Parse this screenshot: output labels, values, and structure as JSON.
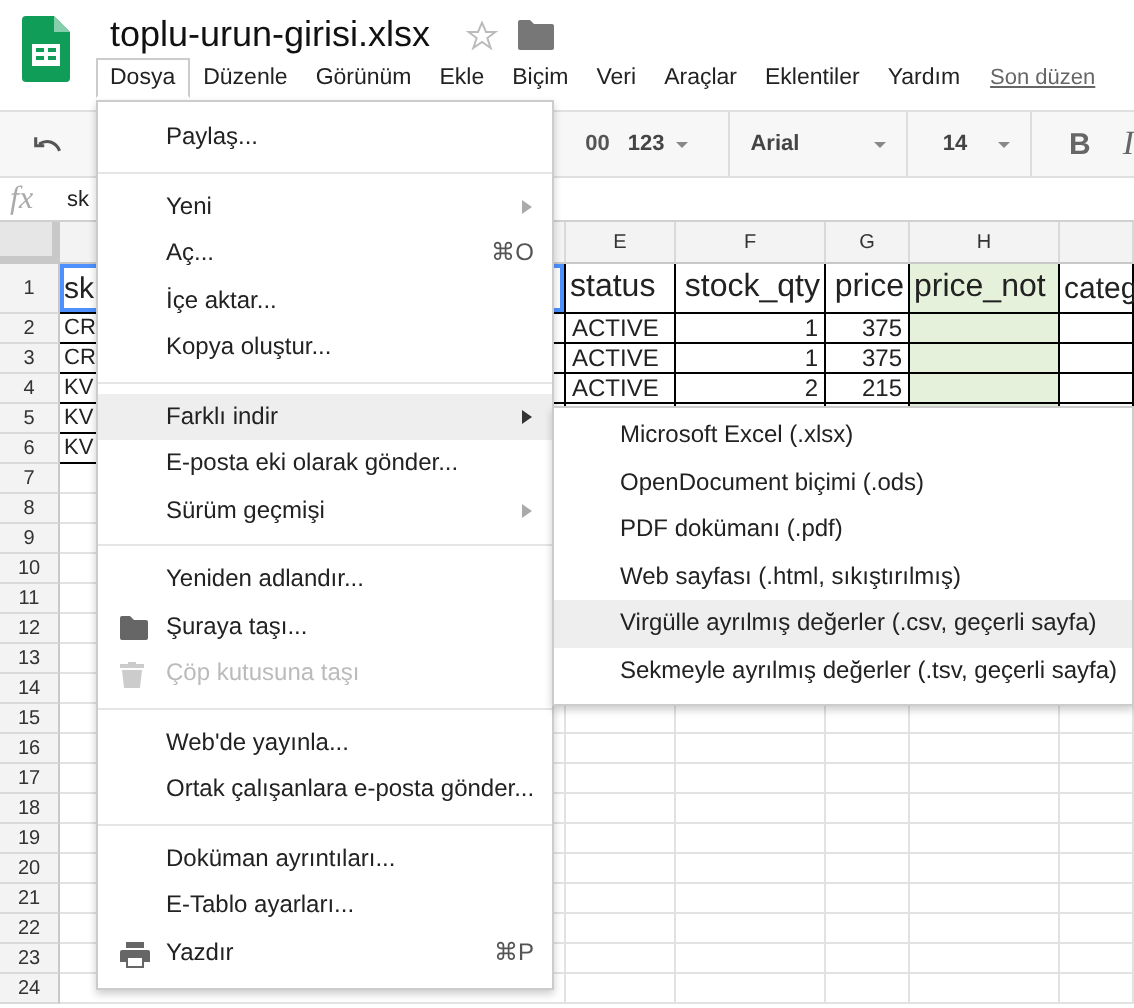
{
  "document": {
    "title": "toplu-urun-girisi.xlsx",
    "starred": false
  },
  "menubar": [
    {
      "label": "Dosya",
      "selected": true
    },
    {
      "label": "Düzenle",
      "selected": false
    },
    {
      "label": "Görünüm",
      "selected": false
    },
    {
      "label": "Ekle",
      "selected": false
    },
    {
      "label": "Biçim",
      "selected": false
    },
    {
      "label": "Veri",
      "selected": false
    },
    {
      "label": "Araçlar",
      "selected": false
    },
    {
      "label": "Eklentiler",
      "selected": false
    },
    {
      "label": "Yardım",
      "selected": false
    }
  ],
  "last_edit_link": "Son düzen",
  "toolbar": {
    "decimal": "00",
    "number_format": "123",
    "font": "Arial",
    "font_size": "14",
    "bold": "B",
    "italic": "I"
  },
  "formula_bar": {
    "fx": "fx",
    "value": "sk"
  },
  "sheet": {
    "columns": [
      {
        "label": "E",
        "numeric": false,
        "highlighted": false
      },
      {
        "label": "F",
        "numeric": true,
        "highlighted": false
      },
      {
        "label": "G",
        "numeric": true,
        "highlighted": false
      },
      {
        "label": "H",
        "numeric": false,
        "highlighted": true
      },
      {}
    ],
    "rows": [
      {
        "number": "1",
        "a": "sk",
        "header": true,
        "cells": [
          "status",
          "stock_qty",
          "price",
          "price_not",
          "categ"
        ]
      },
      {
        "number": "2",
        "a": "CR",
        "cells": [
          "ACTIVE",
          "1",
          "375"
        ]
      },
      {
        "number": "3",
        "a": "CR",
        "cells": [
          "ACTIVE",
          "1",
          "375"
        ]
      },
      {
        "number": "4",
        "a": "KV",
        "cells": [
          "ACTIVE",
          "2",
          "215"
        ]
      },
      {
        "number": "5",
        "a": "KV"
      },
      {
        "number": "6",
        "a": "KV"
      },
      {
        "number": "7"
      },
      {
        "number": "8"
      },
      {
        "number": "9"
      },
      {
        "number": "10"
      },
      {
        "number": "11"
      },
      {
        "number": "12"
      },
      {
        "number": "13"
      },
      {
        "number": "14"
      },
      {
        "number": "15"
      },
      {
        "number": "16"
      },
      {
        "number": "17"
      },
      {
        "number": "18"
      },
      {
        "number": "19"
      },
      {
        "number": "20"
      },
      {
        "number": "21"
      },
      {
        "number": "22"
      },
      {
        "number": "23"
      },
      {
        "number": "24"
      }
    ]
  },
  "file_menu": [
    {
      "kind": "item",
      "label": "Paylaş...",
      "selected": false,
      "disabled": false
    },
    {
      "kind": "separator"
    },
    {
      "kind": "item",
      "label": "Yeni",
      "submenu": true,
      "selected": false,
      "disabled": false
    },
    {
      "kind": "item",
      "label": "Aç...",
      "shortcut": "⌘O",
      "selected": false,
      "disabled": false
    },
    {
      "kind": "item",
      "label": "İçe aktar...",
      "selected": false,
      "disabled": false
    },
    {
      "kind": "item",
      "label": "Kopya oluştur...",
      "selected": false,
      "disabled": false
    },
    {
      "kind": "separator"
    },
    {
      "kind": "item",
      "label": "Farklı indir",
      "submenu": true,
      "selected": true,
      "disabled": false
    },
    {
      "kind": "item",
      "label": "E-posta eki olarak gönder...",
      "selected": false,
      "disabled": false
    },
    {
      "kind": "item",
      "label": "Sürüm geçmişi",
      "submenu": true,
      "selected": false,
      "disabled": false
    },
    {
      "kind": "separator"
    },
    {
      "kind": "item",
      "label": "Yeniden adlandır...",
      "selected": false,
      "disabled": false
    },
    {
      "kind": "item",
      "label": "Şuraya taşı...",
      "icon": true,
      "selected": false,
      "disabled": false
    },
    {
      "kind": "item",
      "label": "Çöp kutusuna taşı",
      "icon": true,
      "selected": false,
      "disabled": true
    },
    {
      "kind": "separator"
    },
    {
      "kind": "item",
      "label": "Web'de yayınla...",
      "selected": false,
      "disabled": false
    },
    {
      "kind": "item",
      "label": "Ortak çalışanlara e-posta gönder...",
      "selected": false,
      "disabled": false
    },
    {
      "kind": "separator"
    },
    {
      "kind": "item",
      "label": "Doküman ayrıntıları...",
      "selected": false,
      "disabled": false
    },
    {
      "kind": "item",
      "label": "E-Tablo ayarları...",
      "selected": false,
      "disabled": false
    },
    {
      "kind": "item",
      "label": "Yazdır",
      "icon": true,
      "shortcut": "⌘P",
      "selected": false,
      "disabled": false
    }
  ],
  "download_submenu": [
    {
      "label": "Microsoft Excel (.xlsx)",
      "selected": false
    },
    {
      "label": "OpenDocument biçimi (.ods)",
      "selected": false
    },
    {
      "label": "PDF dokümanı (.pdf)",
      "selected": false
    },
    {
      "label": "Web sayfası (.html, sıkıştırılmış)",
      "selected": false
    },
    {
      "label": "Virgülle ayrılmış değerler (.csv, geçerli sayfa)",
      "selected": true
    },
    {
      "label": "Sekmeyle ayrılmış değerler (.tsv, geçerli sayfa)",
      "selected": false
    }
  ]
}
